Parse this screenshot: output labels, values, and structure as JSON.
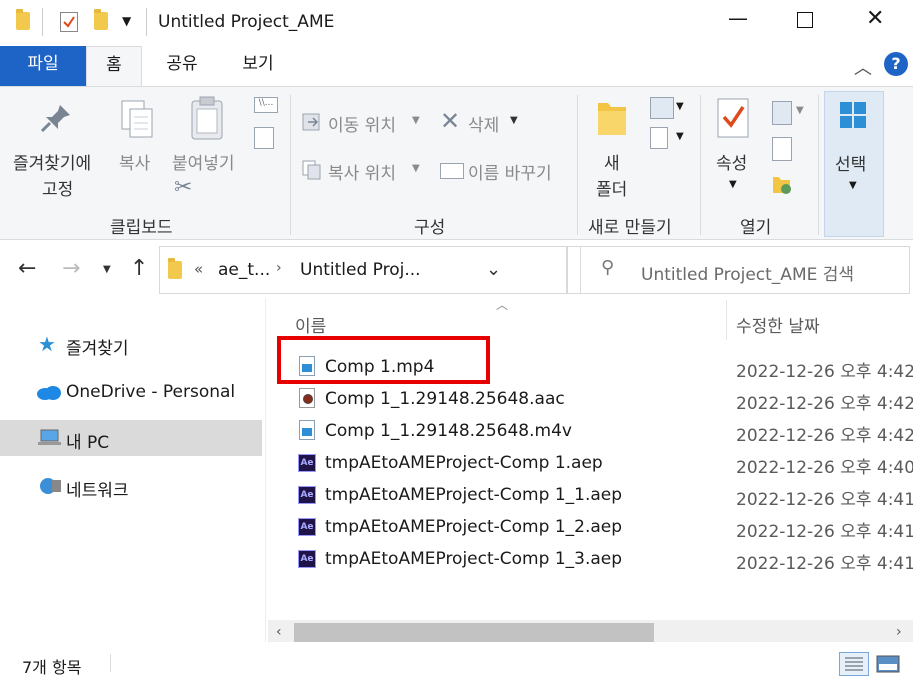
{
  "window": {
    "title": "Untitled Project_AME",
    "controls": {
      "minimize": "—",
      "maximize": "☐",
      "close": "✕"
    }
  },
  "ribbon_tabs": {
    "file": "파일",
    "home": "홈",
    "share": "공유",
    "view": "보기"
  },
  "ribbon": {
    "clipboard": {
      "pin_label_1": "즐겨찾기에",
      "pin_label_2": "고정",
      "copy": "복사",
      "paste": "붙여넣기",
      "group": "클립보드"
    },
    "organize": {
      "move_to": "이동 위치",
      "copy_to": "복사 위치",
      "delete": "삭제",
      "rename": "이름 바꾸기",
      "group": "구성"
    },
    "new": {
      "new_folder_1": "새",
      "new_folder_2": "폴더",
      "group": "새로 만들기"
    },
    "open": {
      "properties": "속성",
      "group": "열기"
    },
    "select": {
      "label": "선택"
    }
  },
  "address": {
    "overflow": "«",
    "crumb1": "ae_t...",
    "crumb2": "Untitled Proj...",
    "search_placeholder": "Untitled Project_AME 검색"
  },
  "nav": {
    "items": [
      {
        "label": "즐겨찾기",
        "icon": "star-icon"
      },
      {
        "label": "OneDrive - Personal",
        "icon": "cloud-icon"
      },
      {
        "label": "내 PC",
        "icon": "computer-icon",
        "selected": true
      },
      {
        "label": "네트워크",
        "icon": "network-icon"
      }
    ]
  },
  "list": {
    "col_name": "이름",
    "col_date": "수정한 날짜",
    "files": [
      {
        "name": "Comp 1.mp4",
        "date": "2022-12-26 오후 4:42",
        "icon": "video-file-icon"
      },
      {
        "name": "Comp 1_1.29148.25648.aac",
        "date": "2022-12-26 오후 4:42",
        "icon": "audio-file-icon"
      },
      {
        "name": "Comp 1_1.29148.25648.m4v",
        "date": "2022-12-26 오후 4:42",
        "icon": "video-file-icon"
      },
      {
        "name": "tmpAEtoAMEProject-Comp 1.aep",
        "date": "2022-12-26 오후 4:40",
        "icon": "ae-file-icon"
      },
      {
        "name": "tmpAEtoAMEProject-Comp 1_1.aep",
        "date": "2022-12-26 오후 4:41",
        "icon": "ae-file-icon"
      },
      {
        "name": "tmpAEtoAMEProject-Comp 1_2.aep",
        "date": "2022-12-26 오후 4:41",
        "icon": "ae-file-icon"
      },
      {
        "name": "tmpAEtoAMEProject-Comp 1_3.aep",
        "date": "2022-12-26 오후 4:41",
        "icon": "ae-file-icon"
      }
    ]
  },
  "status": {
    "count": "7개 항목"
  },
  "colors": {
    "accent": "#1e63c6",
    "highlight": "#e60000",
    "selection": "#e5f3ff"
  }
}
